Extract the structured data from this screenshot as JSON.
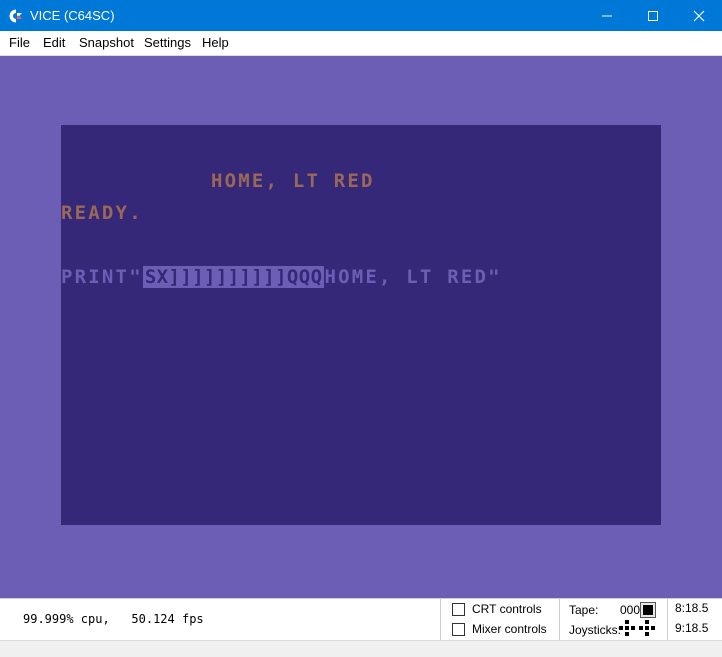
{
  "window": {
    "title": "VICE (C64SC)",
    "icon": "commodore-logo-icon",
    "controls": [
      "minimize-icon",
      "maximize-icon",
      "close-icon"
    ]
  },
  "menu": {
    "file": "File",
    "edit": "Edit",
    "snapshot": "Snapshot",
    "settings": "Settings",
    "help": "Help"
  },
  "screen": {
    "border_color": "#6c5eb5",
    "background_color": "#352879",
    "line1": "HOME, LT RED",
    "line2": "READY.",
    "line3_prefix": "PRINT\"",
    "line3_reverse": "SX]]]]]]]]]]QQQ",
    "line3_suffix": "HOME, LT RED\""
  },
  "status": {
    "cpu": "99.999% cpu,",
    "fps": "50.124 fps",
    "crt_controls": "CRT controls",
    "mixer_controls": "Mixer controls",
    "tape_label": "Tape:",
    "tape_counter": "000",
    "joysticks_label": "Joysticks:",
    "drive8": "8:18.5",
    "drive9": "9:18.5"
  }
}
